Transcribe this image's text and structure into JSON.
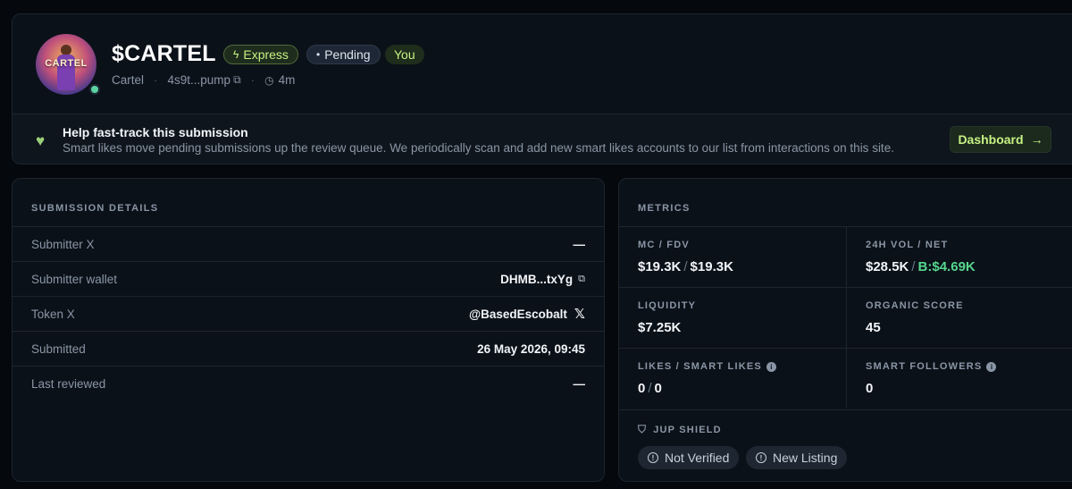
{
  "token": {
    "avatar_text": "CARTEL",
    "name": "$CARTEL",
    "badges": {
      "express": "Express",
      "pending": "Pending",
      "you": "You"
    },
    "subtitle": "Cartel",
    "address": "4s9t...pump",
    "age": "4m"
  },
  "help": {
    "title": "Help fast-track this submission",
    "text": "Smart likes move pending submissions up the review queue. We periodically scan and add new smart likes accounts to our list from interactions on this site.",
    "button": "Dashboard"
  },
  "details": {
    "section": "SUBMISSION DETAILS",
    "rows": [
      {
        "key": "Submitter X",
        "value": "—"
      },
      {
        "key": "Submitter wallet",
        "value": "DHMB...txYg"
      },
      {
        "key": "Token X",
        "value": "@BasedEscobalt"
      },
      {
        "key": "Submitted",
        "value": "26 May 2026, 09:45"
      },
      {
        "key": "Last reviewed",
        "value": "—"
      }
    ]
  },
  "metrics": {
    "section": "METRICS",
    "mc_fdv": {
      "label": "MC / FDV",
      "mc": "$19.3K",
      "fdv": "$19.3K"
    },
    "vol_net": {
      "label": "24H VOL / NET",
      "vol": "$28.5K",
      "net": "B:$4.69K"
    },
    "liquidity": {
      "label": "LIQUIDITY",
      "value": "$7.25K"
    },
    "organic": {
      "label": "ORGANIC SCORE",
      "value": "45"
    },
    "likes": {
      "label": "LIKES / SMART LIKES",
      "likes": "0",
      "smart": "0"
    },
    "followers": {
      "label": "SMART FOLLOWERS",
      "value": "0"
    },
    "shield": {
      "label": "JUP SHIELD",
      "tags": [
        "Not Verified",
        "New Listing"
      ]
    }
  },
  "colors": {
    "accent_green": "#c7f284",
    "positive": "#56d68e",
    "background": "#05080c",
    "card": "#0b1118"
  }
}
